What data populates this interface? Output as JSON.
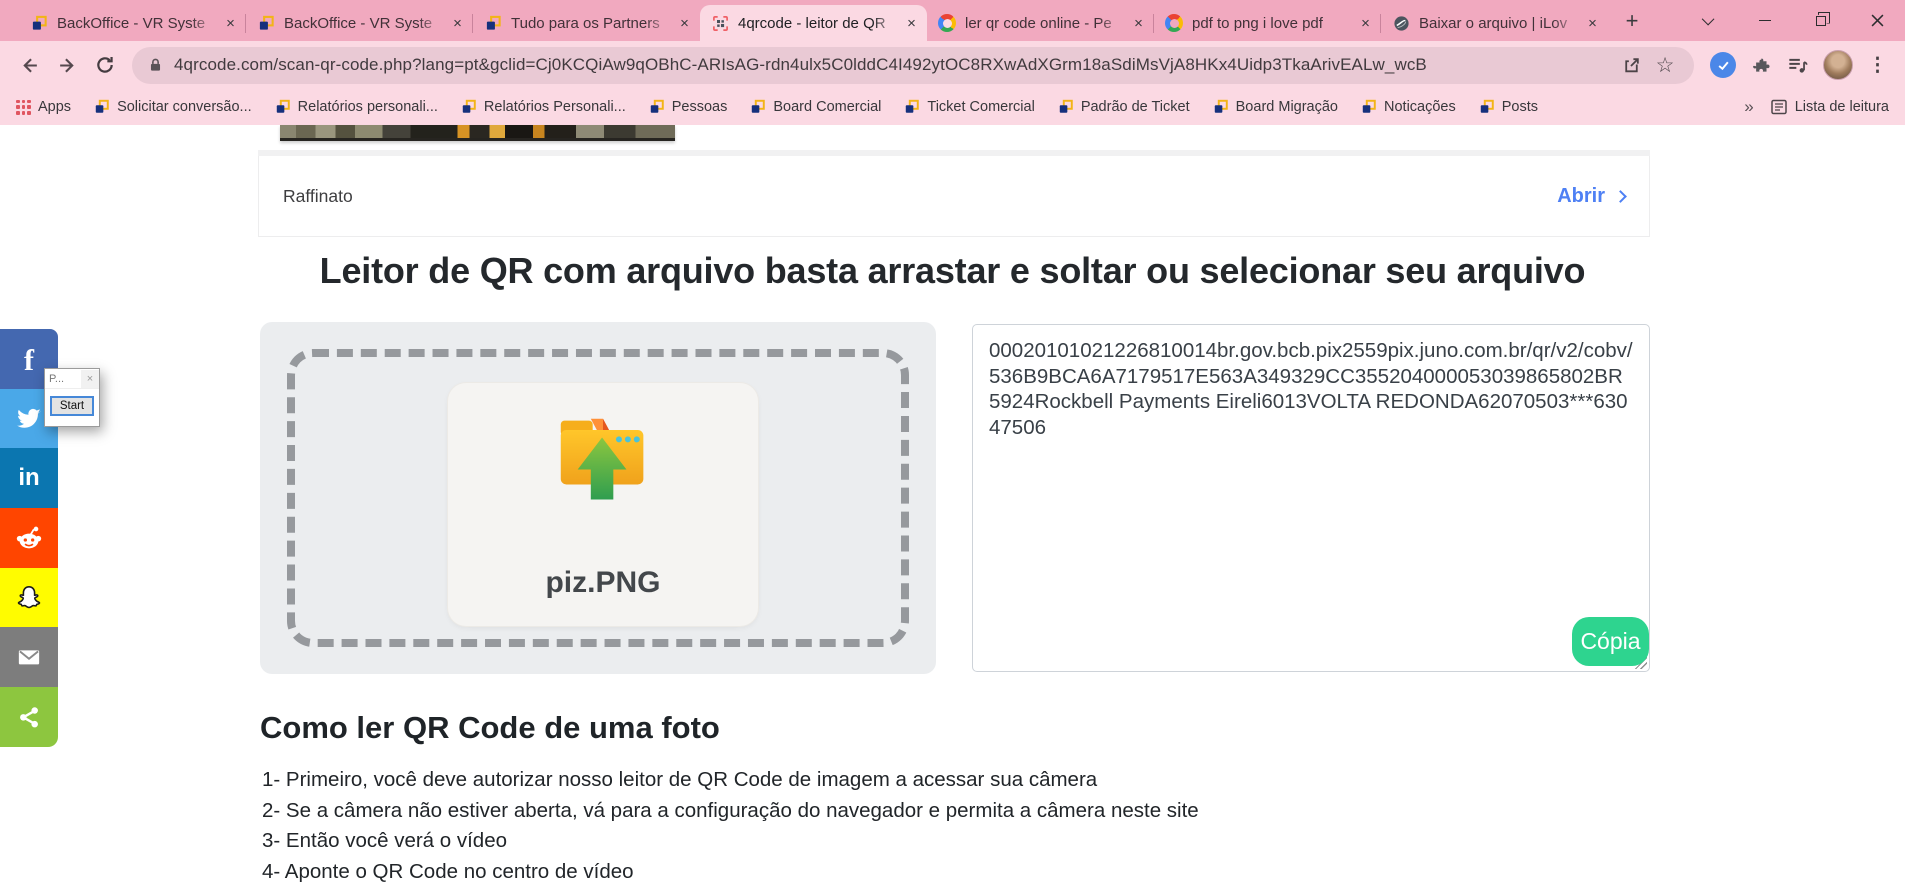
{
  "browser": {
    "tabs": [
      {
        "title": "BackOffice - VR Syste",
        "favicon": "vr-logo",
        "active": false
      },
      {
        "title": "BackOffice - VR Syste",
        "favicon": "vr-logo",
        "active": false
      },
      {
        "title": "Tudo para os Partners",
        "favicon": "vr-logo",
        "active": false
      },
      {
        "title": "4qrcode - leitor de QR",
        "favicon": "qr-scan",
        "active": true
      },
      {
        "title": "ler qr code online - Pe",
        "favicon": "google",
        "active": false
      },
      {
        "title": "pdf to png i love pdf",
        "favicon": "google",
        "active": false
      },
      {
        "title": "Baixar o arquivo | iLov",
        "favicon": "ilovepdf",
        "active": false
      }
    ],
    "url": "4qrcode.com/scan-qr-code.php?lang=pt&gclid=Cj0KCQiAw9qOBhC-ARIsAG-rdn4ulx5C0lddC4I492ytOC8RXwAdXGrm18aSdiMsVjA8HKx4Uidp3TkaArivEALw_wcB",
    "bookmarks": [
      "Apps",
      "Solicitar conversão...",
      "Relatórios personali...",
      "Relatórios Personali...",
      "Pessoas",
      "Board Comercial",
      "Ticket Comercial",
      "Padrão de Ticket",
      "Board Migração",
      "Noticações",
      "Posts"
    ],
    "reading_list_label": "Lista de leitura"
  },
  "icons": {
    "close_tab": "×",
    "new_tab": "+",
    "overflow_chevrons": "»",
    "kebab_menu": "⋮",
    "star": "☆"
  },
  "page": {
    "card_title": "Raffinato",
    "open_link": "Abrir",
    "heading": "Leitor de QR com arquivo basta arrastar e soltar ou selecionar seu arquivo",
    "file_name": "piz.PNG",
    "decoded_text": "00020101021226810014br.gov.bcb.pix2559pix.juno.com.br/qr/v2/cobv/536B9BCA6A7179517E563A349329CC355204000053039865802BR5924Rockbell Payments Eireli6013VOLTA REDONDA62070503***63047506",
    "copy_button": "Cópia",
    "how_title": "Como ler QR Code de uma foto",
    "steps": [
      "1- Primeiro, você deve autorizar nosso leitor de QR Code de imagem a acessar sua câmera",
      "2- Se a câmera não estiver aberta, vá para a configuração do navegador e permita a câmera neste site",
      "3- Então você verá o vídeo",
      "4- Aponte o QR Code no centro de vídeo"
    ]
  },
  "mini_dialog": {
    "title": "P...",
    "button": "Start"
  },
  "social": [
    "facebook",
    "twitter",
    "linkedin",
    "reddit",
    "snapchat",
    "email",
    "share"
  ],
  "colors": {
    "tabstrip_pink": "#f1a9bf",
    "toolbar_pink": "#fbd9e3",
    "urlbar_pink": "#e9c9d4",
    "copy_green": "#2ed48f",
    "link_blue": "#4e80f4",
    "facebook": "#4468b0",
    "twitter": "#4aa8e8",
    "linkedin": "#0b76b0",
    "reddit": "#ff4500",
    "snapchat": "#fffc00",
    "email_gray": "#7d7d7d",
    "share_green": "#8dc63f"
  }
}
